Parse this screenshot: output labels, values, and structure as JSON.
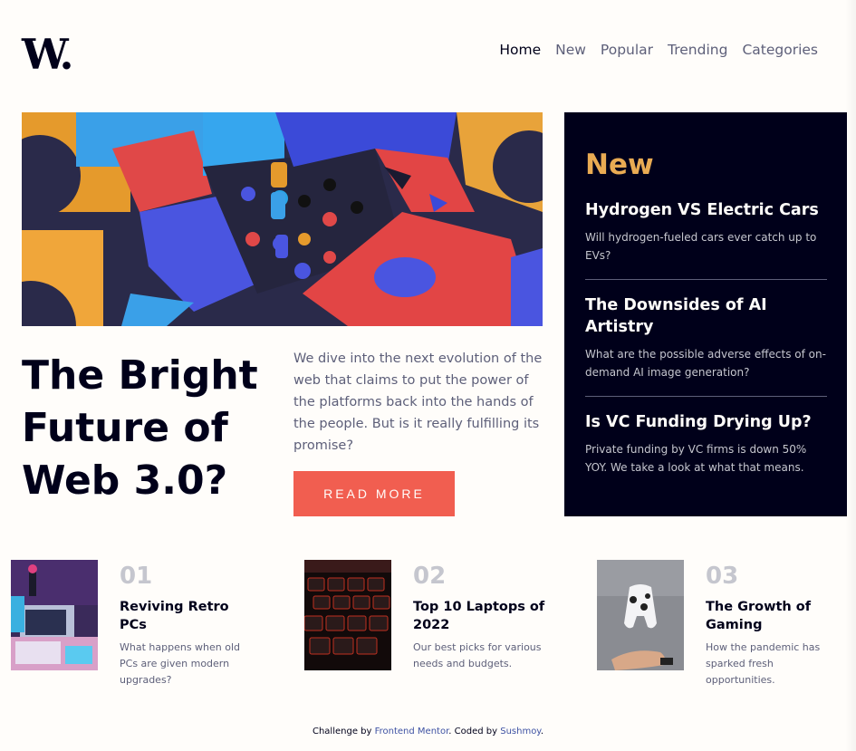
{
  "header": {
    "logo": "W.",
    "nav": [
      "Home",
      "New",
      "Popular",
      "Trending",
      "Categories"
    ]
  },
  "hero": {
    "title": "The Bright Future of Web 3.0?",
    "description": "We dive into the next evolution of the web that claims to put the power of the platforms back into the hands of the people. But is it really fulfilling its promise?",
    "button": "READ MORE"
  },
  "new_section": {
    "heading": "New",
    "items": [
      {
        "title": "Hydrogen VS Electric Cars",
        "text": "Will hydrogen-fueled cars ever catch up to EVs?"
      },
      {
        "title": "The Downsides of AI Artistry",
        "text": "What are the possible adverse effects of on-demand AI image generation?"
      },
      {
        "title": "Is VC Funding Drying Up?",
        "text": "Private funding by VC firms is down 50% YOY. We take a look at what that means."
      }
    ]
  },
  "cards": [
    {
      "num": "01",
      "title": "Reviving Retro PCs",
      "text": "What happens when old PCs are given modern upgrades?"
    },
    {
      "num": "02",
      "title": "Top 10 Laptops of 2022",
      "text": "Our best picks for various needs and budgets."
    },
    {
      "num": "03",
      "title": "The Growth of Gaming",
      "text": "How the pandemic has sparked fresh opportunities."
    }
  ],
  "footer": {
    "prefix": "Challenge by ",
    "link1": "Frontend Mentor",
    "middle": ". Coded by ",
    "link2": "Sushmoy",
    "suffix": "."
  },
  "colors": {
    "accent": "#f15e50",
    "orange": "#e9ab53",
    "dark": "#00001a",
    "grey": "#5d5f79"
  }
}
